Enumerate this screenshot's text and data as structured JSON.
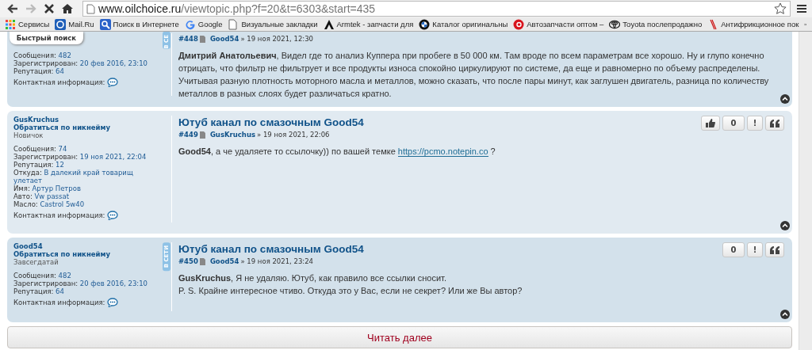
{
  "browser": {
    "back": {
      "disabled": false
    },
    "forward": {
      "disabled": true
    },
    "url": {
      "domain": "www.oilchoice.ru",
      "path": "/viewtopic.php?f=20&t=6303&start=435"
    },
    "bookmarks": [
      {
        "label": "Сервисы"
      },
      {
        "label": "Mail.Ru"
      },
      {
        "label": "Поиск в Интернете"
      },
      {
        "label": "Google"
      },
      {
        "label": "Визуальные закладки"
      },
      {
        "label": "Armtek - запчасти для"
      },
      {
        "label": "Каталог оригинальны"
      },
      {
        "label": "Автозапчасти оптом –"
      },
      {
        "label": "Toyota послепродажно"
      },
      {
        "label": "Антифрикционное пок"
      }
    ]
  },
  "quick_search": {
    "label": "Быстрый поиск"
  },
  "posts": [
    {
      "profile": {
        "fields": [
          {
            "label": "Сообщения:",
            "value": "482"
          },
          {
            "label": "Зарегистрирован:",
            "value": "20 фев 2016, 23:10"
          },
          {
            "label": "Репутация:",
            "value": "64"
          }
        ],
        "contact": "Контактная информация:"
      },
      "online": true,
      "online_label": "В СЕ",
      "number": "#448",
      "author": "Good54",
      "date": "» 19 ноя 2021, 12:30",
      "paragraphs": [
        [
          {
            "kind": "text",
            "text": "**Дмитрий Анатольевич**, Видел где то анализ Куппера при пробеге в 50 000 км. Там вроде по всем параметрам все хорошо. Ну и глупо конечно отрицать, что фильтр не фильтрует и все продукты износа спокойно циркулируют по системе, да еще и равномерно по объему распределены. Учитывая разную плотность моторного масла и металлов, можно сказать, что после пары минут, как заглушен двигатель, разница по количеству металлов в разных слоях будет различаться кратно."
          }
        ]
      ]
    },
    {
      "profile": {
        "name": "GusKruchus",
        "mention": "Обратиться по никнейму",
        "rank": "Новичок",
        "fields": [
          {
            "label": "Сообщения:",
            "value": "74"
          },
          {
            "label": "Зарегистрирован:",
            "value": "19 ноя 2021, 22:04"
          },
          {
            "label": "Репутация:",
            "value": "12"
          },
          {
            "label": "Откуда:",
            "value": "В далекий край товарищ улетает"
          },
          {
            "label": "Имя:",
            "value": "Артур Петров"
          },
          {
            "label": "Авто:",
            "value": "Vw passat"
          },
          {
            "label": "Масло:",
            "value": "Castrol 5w40"
          }
        ],
        "contact": "Контактная информация:"
      },
      "online": false,
      "title": "Ютуб канал по смазочным Good54",
      "number": "#449",
      "author": "GusKruchus",
      "date": "» 19 ноя 2021, 22:06",
      "paragraphs": [
        [
          {
            "kind": "text",
            "text": "**Good54**, а че удаляете то ссылочку)) по вашей темке "
          },
          {
            "kind": "link",
            "text": "https://pcmo.notepin.co"
          },
          {
            "kind": "text",
            "text": " ?"
          }
        ]
      ],
      "buttons": [
        {
          "kind": "like"
        },
        {
          "kind": "count",
          "label": "0"
        },
        {
          "kind": "report",
          "label": "!"
        },
        {
          "kind": "quote"
        }
      ]
    },
    {
      "profile": {
        "name": "Good54",
        "mention": "Обратиться по никнейму",
        "rank": "Завсегдатай",
        "fields": [
          {
            "label": "Сообщения:",
            "value": "482"
          },
          {
            "label": "Зарегистрирован:",
            "value": "20 фев 2016, 23:10"
          },
          {
            "label": "Репутация:",
            "value": "64"
          }
        ],
        "contact": "Контактная информация:"
      },
      "online": true,
      "online_label": "В СЕТИ",
      "title": "Ютуб канал по смазочным Good54",
      "number": "#450",
      "author": "Good54",
      "date": "» 19 ноя 2021, 23:24",
      "paragraphs": [
        [
          {
            "kind": "text",
            "text": "**GusKruchus**, Я не удаляю. Ютуб, как правило все ссылки сносит."
          }
        ],
        [
          {
            "kind": "text",
            "text": "P. S. Крайне интересное чтиво. Откуда это у Вас, если не секрет? Или же Вы автор?"
          }
        ]
      ],
      "buttons": [
        {
          "kind": "count",
          "label": "0"
        },
        {
          "kind": "report",
          "label": "!"
        },
        {
          "kind": "quote"
        }
      ]
    }
  ],
  "read_more": {
    "label": "Читать далее"
  }
}
